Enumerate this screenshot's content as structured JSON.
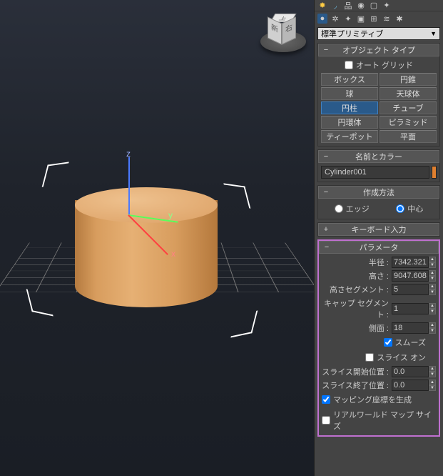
{
  "dropdown": {
    "selected": "標準プリミティブ"
  },
  "topIcons": {
    "sun": "sun-icon",
    "arc": "arc-icon",
    "hierarchy": "hierarchy-icon",
    "motion": "motion-icon",
    "display": "display-icon",
    "hammer": "hammer-icon"
  },
  "cmdIcons": {
    "sphere": "sphere-icon",
    "shapes": "shapes-icon",
    "lights": "light-icon",
    "camera": "camera-icon",
    "helpers": "helper-icon",
    "space": "spacewarp-icon",
    "systems": "systems-icon"
  },
  "objectType": {
    "title": "オブジェクト タイプ",
    "autogrid": "オート グリッド",
    "autogrid_checked": false,
    "buttons": [
      [
        "ボックス",
        "円錐"
      ],
      [
        "球",
        "天球体"
      ],
      [
        "円柱",
        "チューブ"
      ],
      [
        "円環体",
        "ピラミッド"
      ],
      [
        "ティーポット",
        "平面"
      ]
    ],
    "active": "円柱"
  },
  "nameColor": {
    "title": "名前とカラー",
    "name": "Cylinder001",
    "color": "#e08030"
  },
  "creationMethod": {
    "title": "作成方法",
    "edge": "エッジ",
    "center": "中心",
    "selected": "center"
  },
  "keyboard": {
    "title": "キーボード入力"
  },
  "params": {
    "title": "パラメータ",
    "radius_label": "半径 :",
    "radius": "7342.321",
    "height_label": "高さ :",
    "height": "9047.608",
    "hseg_label": "高さセグメント :",
    "hseg": "5",
    "capseg_label": "キャップ セグメント :",
    "capseg": "1",
    "sides_label": "側面 :",
    "sides": "18",
    "smooth": "スムーズ",
    "smooth_checked": true,
    "slice_on": "スライス オン",
    "slice_on_checked": false,
    "slice_from_label": "スライス開始位置 :",
    "slice_from": "0.0",
    "slice_to_label": "スライス終了位置 :",
    "slice_to": "0.0",
    "gen_mapping": "マッピング座標を生成",
    "gen_mapping_checked": true,
    "real_world": "リアルワールド マップ サイズ",
    "real_world_checked": false
  },
  "axis": {
    "x": "x",
    "y": "y",
    "z": "z"
  },
  "viewcube": {
    "front": "新",
    "right": "右",
    "top": "上"
  }
}
